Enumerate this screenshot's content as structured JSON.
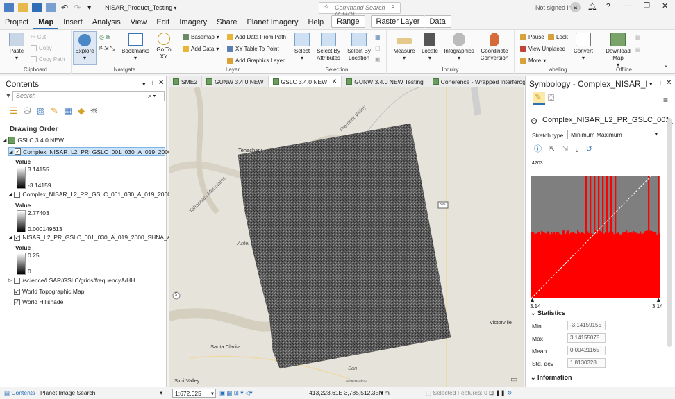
{
  "app": {
    "title": "NISAR_Product_Testing",
    "signin": "Not signed in",
    "avatar": "a"
  },
  "command_search": {
    "placeholder": "Command Search (Alt+Q)"
  },
  "menu": {
    "tabs": [
      "Project",
      "Map",
      "Insert",
      "Analysis",
      "View",
      "Edit",
      "Imagery",
      "Share",
      "Planet Imagery",
      "Help"
    ],
    "context_tabs": [
      "Range",
      "Raster Layer",
      "Data"
    ]
  },
  "ribbon": {
    "clipboard": {
      "paste": "Paste",
      "cut": "Cut",
      "copy": "Copy",
      "copy_path": "Copy Path",
      "label": "Clipboard"
    },
    "navigate": {
      "explore": "Explore",
      "bookmarks": "Bookmarks",
      "goto": "Go To XY",
      "label": "Navigate"
    },
    "layer": {
      "basemap": "Basemap",
      "add_data": "Add Data",
      "add_data_from_path": "Add Data From Path",
      "xy_table": "XY Table To Point",
      "add_graphics": "Add Graphics Layer",
      "label": "Layer"
    },
    "selection": {
      "select": "Select",
      "select_by_attr": "Select By Attributes",
      "select_by_loc": "Select By Location",
      "label": "Selection"
    },
    "inquiry": {
      "measure": "Measure",
      "locate": "Locate",
      "infographics": "Infographics",
      "coord": "Coordinate Conversion",
      "label": "Inquiry"
    },
    "labeling": {
      "pause": "Pause",
      "lock": "Lock",
      "view_unplaced": "View Unplaced",
      "more": "More",
      "convert": "Convert",
      "label": "Labeling"
    },
    "offline": {
      "download": "Download Map",
      "label": "Offline"
    }
  },
  "contents": {
    "title": "Contents",
    "search_placeholder": "Search",
    "drawing_order": "Drawing Order",
    "map_name": "GSLC 3.4.0 NEW",
    "layers": [
      {
        "name": "Complex_NISAR_L2_PR_GSLC_001_030_A_019_2000_SHNA_...",
        "checked": true,
        "value_label": "Value",
        "max": "3.14155",
        "min": "-3.14159"
      },
      {
        "name": "Complex_NISAR_L2_PR_GSLC_001_030_A_019_2000_SHNA_...",
        "checked": false,
        "value_label": "Value",
        "max": "2.77403",
        "min": "0.000149613"
      },
      {
        "name": "NISAR_L2_PR_GSLC_001_030_A_019_2000_SHNA_A_200810...",
        "checked": true,
        "value_label": "Value",
        "max": "0.25",
        "min": "0"
      },
      {
        "name": "/science/LSAR/GSLC/grids/frequencyA/HH",
        "checked": false
      },
      {
        "name": "World Topographic Map",
        "checked": true
      },
      {
        "name": "World Hillshade",
        "checked": true
      }
    ]
  },
  "map_tabs": [
    "SME2",
    "GUNW 3.4.0 NEW",
    "GSLC 3.4.0 NEW",
    "GUNW 3.4.0 NEW Testing",
    "Coherence - Wrapped Interferogram"
  ],
  "map_labels": {
    "tehachapi": "Tehachapi",
    "tehachapi_mtns": "Tehachapi Mountains",
    "fremont": "Fremont Valley",
    "antelope": "Antel",
    "victorville": "Victorville",
    "santa_clarita": "Santa Clarita",
    "simi_valley": "Simi Valley",
    "route395": "395",
    "route5": "5",
    "san": "San",
    "mtns": "Mountains"
  },
  "symbology": {
    "title": "Symbology - Complex_NISAR_L2_P...",
    "layer": "Complex_NISAR_L2_PR_GSLC_001_030...",
    "stretch_label": "Stretch type",
    "stretch_value": "Minimum Maximum",
    "hist_max": "4203",
    "axis_min": "3.14",
    "axis_max": "3.14",
    "statistics": "Statistics",
    "stats": [
      {
        "label": "Min",
        "value": "-3.14159155"
      },
      {
        "label": "Max",
        "value": "3.14155078"
      },
      {
        "label": "Mean",
        "value": "0.00421165"
      },
      {
        "label": "Std. dev",
        "value": "1.8130328"
      }
    ],
    "information": "Information"
  },
  "status": {
    "contents_tab": "Contents",
    "planet_tab": "Planet Image Search",
    "scale": "1:672,025",
    "coords": "413,223.61E 3,785,512.35N m",
    "selected": "Selected Features: 0"
  },
  "colors": {
    "accent": "#2b6fb6",
    "histogram": "#ff0000",
    "histogram_bg": "#7f7f7f"
  }
}
